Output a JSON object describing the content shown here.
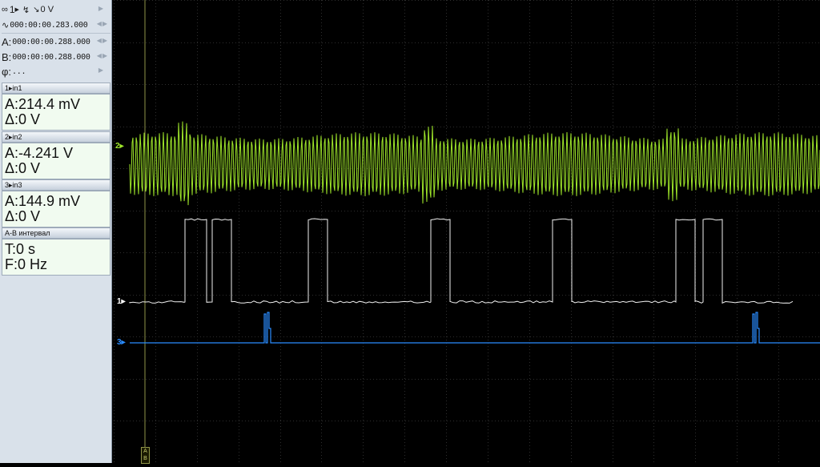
{
  "trigger": {
    "channel": "1",
    "slope_icon": "falling-edge-icon",
    "level": "0 V",
    "mode_icon": "trigger-mode-icon"
  },
  "cursors": {
    "delay": "000:00:00.283.000",
    "a_label": "A:",
    "a": "000:00:00.288.000",
    "b_label": "B:",
    "b": "000:00:00.288.000",
    "phi_label": "φ:",
    "phi": "..."
  },
  "channels": [
    {
      "header": "1▸in1",
      "a": "A:214.4 mV",
      "d": "Δ:0 V",
      "color": "#ffffff",
      "marker": "1▸"
    },
    {
      "header": "2▸in2",
      "a": "A:-4.241 V",
      "d": "Δ:0 V",
      "color": "#9ee52a",
      "marker": "2▸"
    },
    {
      "header": "3▸in3",
      "a": "A:144.9 mV",
      "d": "Δ:0 V",
      "color": "#2a8cff",
      "marker": "3▸"
    }
  ],
  "interval": {
    "header": "A-B интервал",
    "t": "T:0 s",
    "f": "F:0 Hz"
  },
  "cursor_marker": {
    "a": "A",
    "b": "B"
  },
  "colors": {
    "panel_bg": "#d9e1ea",
    "value_bg": "#f1fbf0",
    "grid": "#3a3a3a",
    "cursor": "#9aa04a"
  }
}
